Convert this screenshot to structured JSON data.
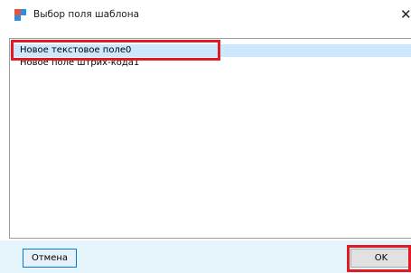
{
  "window": {
    "title": "Выбор поля шаблона",
    "close_glyph": "✕",
    "icon": "app-icon"
  },
  "list": {
    "items": [
      {
        "label": "Новое текстовое поле0",
        "selected": true
      },
      {
        "label": "Новое поле штрих-кода1",
        "selected": false
      }
    ]
  },
  "buttons": {
    "cancel_label": "Отмена",
    "ok_label": "OK"
  },
  "colors": {
    "selection": "#cce8ff",
    "highlight": "#e01b24",
    "accent": "#0078d7",
    "bottom_bar": "#e6f4fb"
  }
}
